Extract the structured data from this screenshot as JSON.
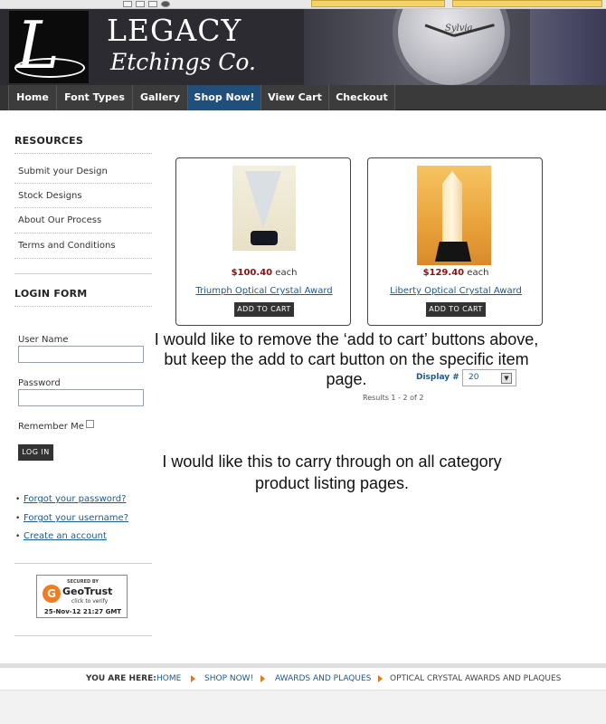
{
  "brand": {
    "logo_letter": "L",
    "name_line1": "LEGACY",
    "name_line2": "Etchings Co.",
    "clock_mark": "Sylvia"
  },
  "nav": {
    "items": [
      "Home",
      "Font Types",
      "Gallery",
      "Shop Now!",
      "View Cart",
      "Checkout"
    ],
    "active": "Shop Now!"
  },
  "sidebar": {
    "resources_title": "RESOURCES",
    "resources": [
      "Submit your Design",
      "Stock Designs",
      "About Our Process",
      "Terms and Conditions"
    ],
    "login_title": "LOGIN FORM",
    "username_label": "User Name",
    "password_label": "Password",
    "remember_label": "Remember Me",
    "login_button": "LOG IN",
    "links": [
      "Forgot your password?",
      "Forgot your username?",
      "Create an account"
    ]
  },
  "geotrust": {
    "secured": "SECURED BY",
    "name": "GeoTrust",
    "verify": "click to verify",
    "date": "25-Nov-12 21:27 GMT"
  },
  "products": [
    {
      "price": "$100.40",
      "unit": "each",
      "name": "Triumph Optical Crystal Award",
      "button": "ADD TO CART"
    },
    {
      "price": "$129.40",
      "unit": "each",
      "name": "Liberty Optical Crystal Award",
      "button": "ADD TO CART"
    }
  ],
  "pagination": {
    "display_label": "Display #",
    "display_value": "20",
    "results": "Results 1 - 2 of 2"
  },
  "annotations": {
    "note1_line1": "I would like to remove the ‘add to cart’ buttons above,",
    "note1_line2": "but keep the add to cart button on the specific item",
    "note1_line3": "page.",
    "note2_line1": "I would like this to carry through on all category",
    "note2_line2": "product listing pages."
  },
  "breadcrumb": {
    "label": "YOU ARE HERE:",
    "items": [
      "HOME",
      "SHOP NOW!",
      "AWARDS AND PLAQUES"
    ],
    "current": "OPTICAL CRYSTAL AWARDS AND PLAQUES"
  },
  "colors": {
    "nav_bg": "#3a3a3a",
    "nav_active": "#1f4f7a",
    "link": "#1c5a8a",
    "price": "#8b1111",
    "crumb_arrow": "#e07a12"
  }
}
